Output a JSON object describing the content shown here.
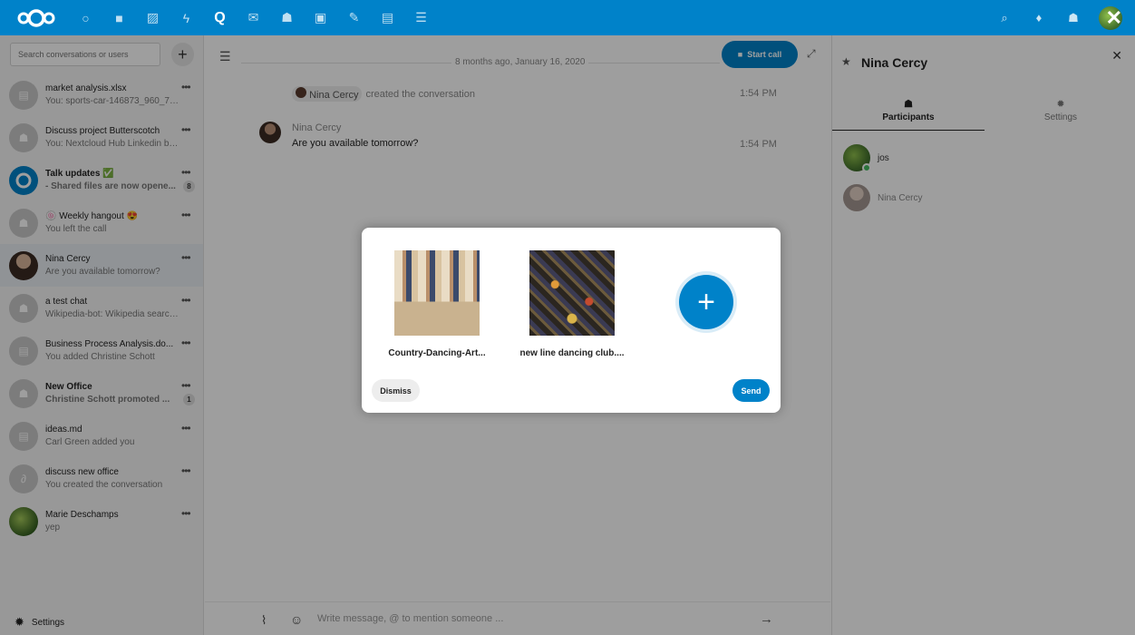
{
  "topbar": {
    "apps": [
      {
        "icon": "dashboard-icon",
        "glyph": "○"
      },
      {
        "icon": "files-icon",
        "glyph": "■"
      },
      {
        "icon": "photos-icon",
        "glyph": "▨"
      },
      {
        "icon": "activity-icon",
        "glyph": "ϟ"
      },
      {
        "icon": "talk-icon",
        "glyph": "Q"
      },
      {
        "icon": "mail-icon",
        "glyph": "✉"
      },
      {
        "icon": "contacts-icon",
        "glyph": "☗"
      },
      {
        "icon": "calendar-icon",
        "glyph": "▣"
      },
      {
        "icon": "notes-icon",
        "glyph": "✎"
      },
      {
        "icon": "deck-icon",
        "glyph": "▤"
      },
      {
        "icon": "tasks-icon",
        "glyph": "☰"
      }
    ]
  },
  "sidebar": {
    "search_placeholder": "Search conversations or users",
    "add_label": "+",
    "conversations": [
      {
        "name": "market analysis.xlsx",
        "last": "You: sports-car-146873_960_720.p...",
        "bold": false,
        "badge": ""
      },
      {
        "name": "Discuss project Butterscotch",
        "last": "You: Nextcloud Hub Linkedin back...",
        "bold": false,
        "badge": ""
      },
      {
        "name": "Talk updates ✅",
        "last": "- Shared files are now opene...",
        "bold": true,
        "badge": "8"
      },
      {
        "name": "🍥 Weekly hangout 😍",
        "last": "You left the call",
        "bold": false,
        "badge": ""
      },
      {
        "name": "Nina Cercy",
        "last": "Are you available tomorrow?",
        "bold": false,
        "badge": ""
      },
      {
        "name": "a test chat",
        "last": "Wikipedia-bot: Wikipedia search re...",
        "bold": false,
        "badge": ""
      },
      {
        "name": "Business Process Analysis.do...",
        "last": "You added Christine Schott",
        "bold": false,
        "badge": ""
      },
      {
        "name": "New Office",
        "last": "Christine Schott promoted ...",
        "bold": true,
        "badge": "1"
      },
      {
        "name": "ideas.md",
        "last": "Carl Green added you",
        "bold": false,
        "badge": ""
      },
      {
        "name": "discuss new office",
        "last": "You created the conversation",
        "bold": false,
        "badge": ""
      },
      {
        "name": "Marie Deschamps",
        "last": "yep",
        "bold": false,
        "badge": ""
      }
    ],
    "settings_label": "Settings"
  },
  "chat": {
    "date_label": "8 months ago, January 16, 2020",
    "start_call_label": "Start call",
    "system_author": "Nina Cercy",
    "system_text": "created the conversation",
    "system_time": "1:54 PM",
    "message_author": "Nina Cercy",
    "message_text": "Are you available tomorrow?",
    "message_time": "1:54 PM",
    "composer_placeholder": "Write message, @ to mention someone ..."
  },
  "right": {
    "title": "Nina Cercy",
    "tabs": [
      {
        "label": "Participants"
      },
      {
        "label": "Settings"
      }
    ],
    "participants": [
      {
        "name": "jos"
      },
      {
        "name": "Nina Cercy"
      }
    ]
  },
  "modal": {
    "files": [
      {
        "name": "Country-Dancing-Art..."
      },
      {
        "name": "new line dancing club...."
      }
    ],
    "dismiss_label": "Dismiss",
    "send_label": "Send"
  }
}
